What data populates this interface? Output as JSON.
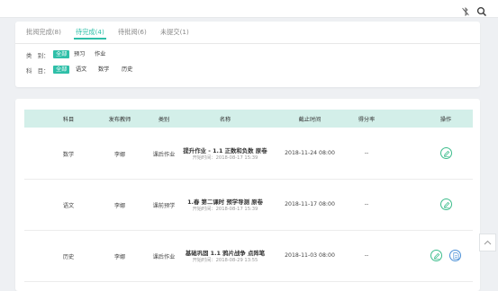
{
  "tabs": [
    {
      "label": "批阅完成(8)",
      "active": false
    },
    {
      "label": "待完成(4)",
      "active": true
    },
    {
      "label": "待批阅(6)",
      "active": false
    },
    {
      "label": "未提交(1)",
      "active": false
    }
  ],
  "filters": {
    "category": {
      "label": "类　别：",
      "options": [
        "全部",
        "预习",
        "作业"
      ],
      "selected": "全部"
    },
    "subject": {
      "label": "科　目：",
      "options": [
        "全部",
        "语文",
        "数学",
        "历史"
      ],
      "selected": "全部"
    }
  },
  "table": {
    "headers": [
      "科目",
      "发布教师",
      "类别",
      "名称",
      "截止时间",
      "得分率",
      "操作"
    ],
    "rows": [
      {
        "subject": "数学",
        "teacher": "李娜",
        "type": "课后作业",
        "title": "提升作业 - 1.1 正数和负数 原卷",
        "start": "开始时间：2018-08-17 15:39",
        "deadline": "2018-11-24 08:00",
        "score": "--",
        "actions": [
          "edit"
        ]
      },
      {
        "subject": "语文",
        "teacher": "李娜",
        "type": "课前预学",
        "title": "1.春 第二课时 预学导测 原卷",
        "start": "开始时间：2018-08-17 15:39",
        "deadline": "2018-11-17 08:00",
        "score": "--",
        "actions": [
          "edit"
        ]
      },
      {
        "subject": "历史",
        "teacher": "李娜",
        "type": "课后作业",
        "title": "基础巩固 1.1 鸦片战争 点阵笔",
        "start": "开始时间：2018-08-29 13:55",
        "deadline": "2018-11-03 08:00",
        "score": "--",
        "actions": [
          "edit",
          "doc"
        ]
      }
    ]
  },
  "icons": {
    "bluetooth": "bluetooth-off-icon",
    "search": "search-icon",
    "edit": "pencil-icon",
    "doc": "document-icon",
    "scroll": "chevron-up-icon"
  },
  "colors": {
    "accent": "#2ebfa8",
    "header_bg": "#d3efe9",
    "page_bg": "#eef0f3",
    "edit": "#3dbd8c",
    "doc": "#4a8fd6"
  }
}
